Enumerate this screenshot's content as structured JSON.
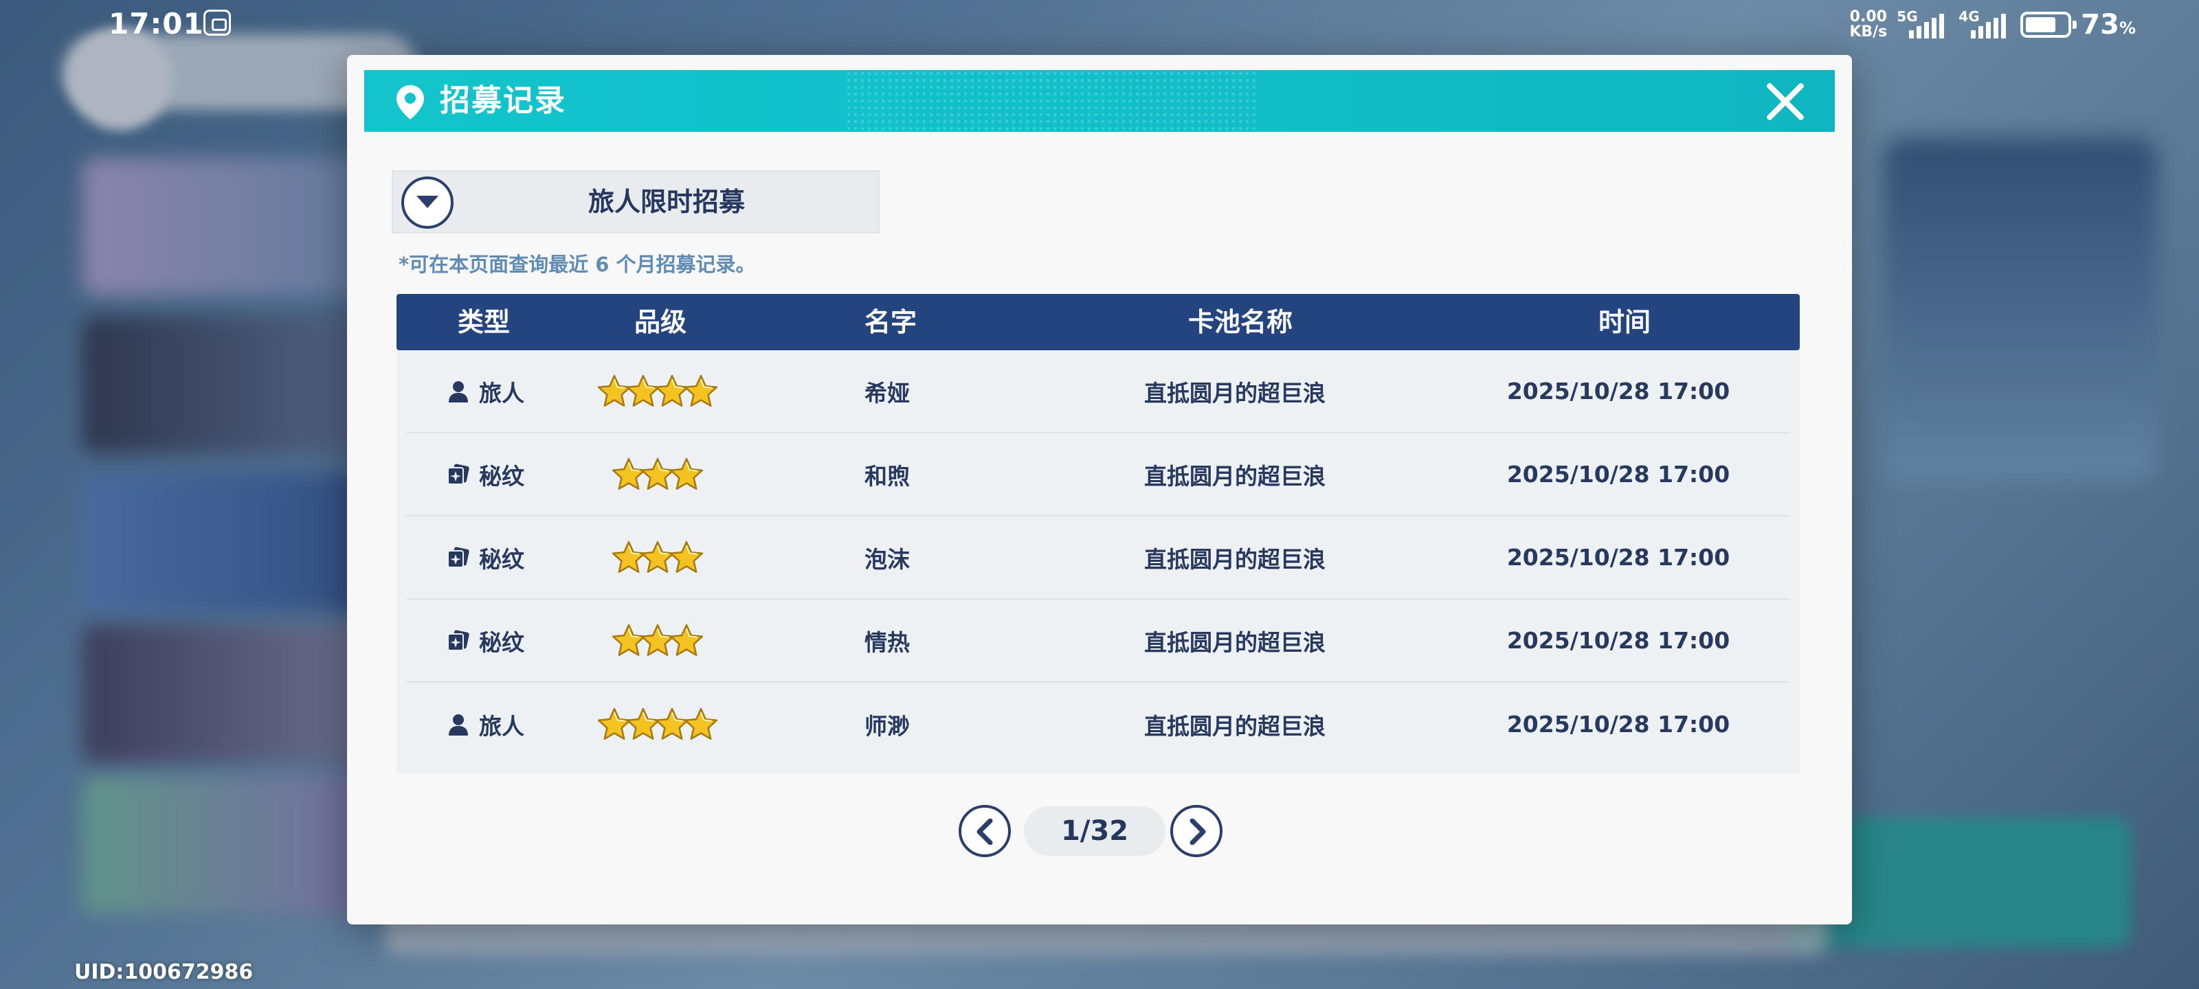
{
  "status_bar": {
    "time": "17:01",
    "net_speed_value": "0.00",
    "net_speed_unit": "KB/s",
    "signal_1": "5G",
    "signal_2": "4G",
    "battery_level": 73,
    "battery_text": "73",
    "battery_unit": "%"
  },
  "user": {
    "uid": "UID:100672986"
  },
  "dialog": {
    "title": "招募记录",
    "pool_selector": {
      "selected": "旅人限时招募"
    },
    "note": "*可在本页面查询最近 6 个月招募记录。",
    "table": {
      "headers": [
        "类型",
        "品级",
        "名字",
        "卡池名称",
        "时间"
      ],
      "rows": [
        {
          "type": "旅人",
          "type_icon": "person-icon",
          "stars": 4,
          "name": "希娅",
          "pool": "直抵圆月的超巨浪",
          "time": "2025/10/28 17:00"
        },
        {
          "type": "秘纹",
          "type_icon": "rune-card-icon",
          "stars": 3,
          "name": "和煦",
          "pool": "直抵圆月的超巨浪",
          "time": "2025/10/28 17:00"
        },
        {
          "type": "秘纹",
          "type_icon": "rune-card-icon",
          "stars": 3,
          "name": "泡沫",
          "pool": "直抵圆月的超巨浪",
          "time": "2025/10/28 17:00"
        },
        {
          "type": "秘纹",
          "type_icon": "rune-card-icon",
          "stars": 3,
          "name": "情热",
          "pool": "直抵圆月的超巨浪",
          "time": "2025/10/28 17:00"
        },
        {
          "type": "旅人",
          "type_icon": "person-icon",
          "stars": 4,
          "name": "师渺",
          "pool": "直抵圆月的超巨浪",
          "time": "2025/10/28 17:00"
        }
      ]
    },
    "pagination": {
      "current": "1/32"
    }
  },
  "colors": {
    "header_teal": "#13c4cd",
    "table_header_navy": "#24447f",
    "text_navy": "#27395f",
    "note_blue": "#5f8bb4",
    "star_gold": "#f5c321"
  }
}
